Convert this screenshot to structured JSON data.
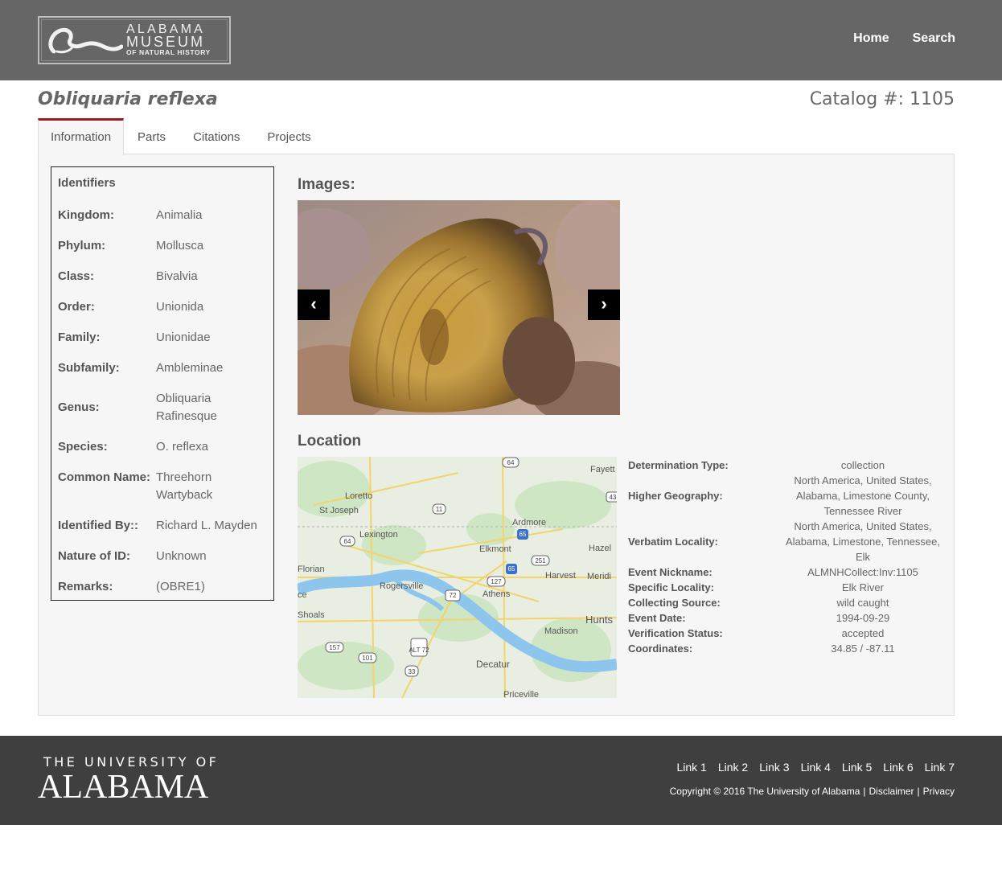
{
  "header": {
    "logo": {
      "line1": "ALABAMA",
      "line2": "MUSEUM",
      "line3": "OF NATURAL HISTORY"
    },
    "nav": [
      "Home",
      "Search"
    ]
  },
  "record": {
    "title": "Obliquaria reflexa",
    "catalog": "Catalog #: 1105"
  },
  "tabs": [
    "Information",
    "Parts",
    "Citations",
    "Projects"
  ],
  "identifiers": {
    "heading": "Identifiers",
    "rows": [
      {
        "k": "Kingdom:",
        "v": "Animalia"
      },
      {
        "k": "Phylum:",
        "v": "Mollusca"
      },
      {
        "k": "Class:",
        "v": "Bivalvia"
      },
      {
        "k": "Order:",
        "v": "Unionida"
      },
      {
        "k": "Family:",
        "v": "Unionidae"
      },
      {
        "k": "Subfamily:",
        "v": "Ambleminae"
      },
      {
        "k": "Genus:",
        "v": "Obliquaria Rafinesque"
      },
      {
        "k": "Species:",
        "v": "O. reflexa"
      },
      {
        "k": "Common Name:",
        "v": "Threehorn Wartyback"
      },
      {
        "k": "Identified By::",
        "v": "Richard L. Mayden"
      },
      {
        "k": "Nature of ID:",
        "v": "Unknown"
      },
      {
        "k": "Remarks:",
        "v": "(OBRE1)"
      }
    ]
  },
  "images": {
    "heading": "Images:",
    "prev": "‹",
    "next": "›"
  },
  "location": {
    "heading": "Location",
    "map_labels": [
      "Fayett",
      "Loretto",
      "St Joseph",
      "Ardmore",
      "Lexington",
      "Elkmont",
      "Hazel",
      "Florian",
      "Harvest",
      "Meridi",
      "Rogersville",
      "Athens",
      "Shoals",
      "Hunts",
      "Madison",
      "Decatur",
      "Priceville",
      "ce"
    ],
    "map_shields": [
      "64",
      "43",
      "11",
      "65",
      "64",
      "251",
      "65",
      "127",
      "72",
      "ALT 72",
      "157",
      "101",
      "33"
    ]
  },
  "details": [
    {
      "k": "Determination Type:",
      "v": "collection"
    },
    {
      "k": "Higher Geography:",
      "v": "North America, United States, Alabama, Limestone County, Tennessee River"
    },
    {
      "k": "Verbatim Locality:",
      "v": "North America, United States, Alabama, Limestone, Tennessee, Elk"
    },
    {
      "k": "Event Nickname:",
      "v": "ALMNHCollect:Inv:1105"
    },
    {
      "k": "Specific Locality:",
      "v": "Elk River"
    },
    {
      "k": "Collecting Source:",
      "v": "wild caught"
    },
    {
      "k": "Event Date:",
      "v": "1994-09-29"
    },
    {
      "k": "Verification Status:",
      "v": "accepted"
    },
    {
      "k": "Coordinates:",
      "v": "34.85 / -87.11"
    }
  ],
  "footer": {
    "ua_small": "THE UNIVERSITY OF",
    "ua_big": "ALABAMA",
    "links": [
      "Link 1",
      "Link 2",
      "Link 3",
      "Link 4",
      "Link 5",
      "Link 6",
      "Link 7"
    ],
    "copyright": "Copyright © 2016 The University of Alabama",
    "sep": "|",
    "disclaimer": "Disclaimer",
    "privacy": "Privacy"
  }
}
